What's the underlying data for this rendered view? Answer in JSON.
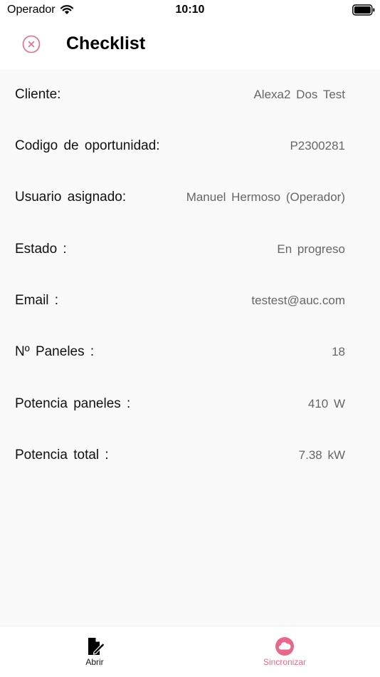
{
  "status_bar": {
    "carrier": "Operador",
    "time": "10:10"
  },
  "header": {
    "title": "Checklist",
    "close_icon": "close-circle-icon"
  },
  "details": [
    {
      "label": "Cliente:",
      "value": "Alexa2 Dos Test"
    },
    {
      "label": "Codigo de oportunidad:",
      "value": "P2300281"
    },
    {
      "label": "Usuario asignado:",
      "value": "Manuel Hermoso (Operador)"
    },
    {
      "label": "Estado :",
      "value": "En progreso"
    },
    {
      "label": "Email :",
      "value": "testest@auc.com"
    },
    {
      "label": "Nº Paneles :",
      "value": "18"
    },
    {
      "label": "Potencia paneles :",
      "value": "410 W"
    },
    {
      "label": "Potencia total :",
      "value": "7.38 kW"
    }
  ],
  "tab_bar": {
    "open": {
      "label": "Abrir",
      "icon": "document-edit-icon"
    },
    "sync": {
      "label": "Sincronizar",
      "icon": "cloud-icon"
    }
  },
  "colors": {
    "accent": "#e8678a",
    "background": "#f9f9f9",
    "value_text": "#666666"
  }
}
